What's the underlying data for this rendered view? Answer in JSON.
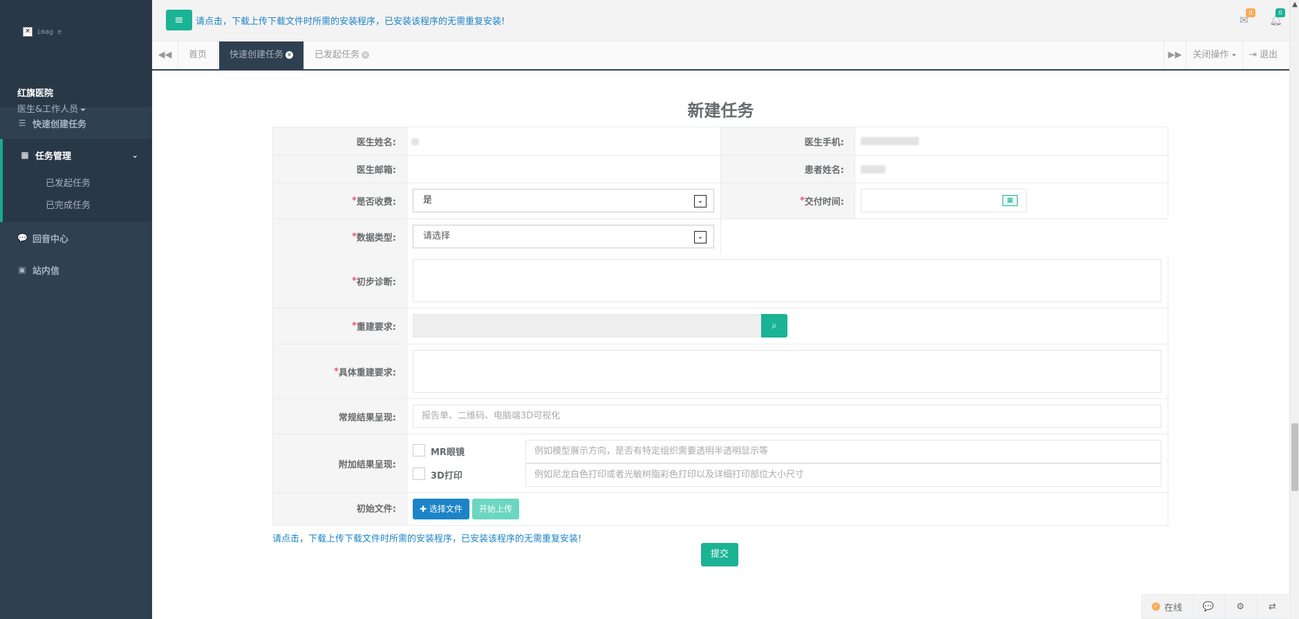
{
  "sidebar": {
    "avatar_alt": "imag e",
    "hospital": "红旗医院",
    "role": "医生&工作人员",
    "items": [
      {
        "label": "快速创建任务",
        "icon": "sliders-icon"
      },
      {
        "label": "任务管理",
        "icon": "list-icon",
        "expanded": true,
        "children": [
          {
            "label": "已发起任务"
          },
          {
            "label": "已完成任务"
          }
        ]
      },
      {
        "label": "回音中心",
        "icon": "chat-icon"
      },
      {
        "label": "站内信",
        "icon": "mail-box-icon"
      }
    ]
  },
  "topbar": {
    "notice": "请点击，下载上传下载文件时所需的安装程序，已安装该程序的无需重复安装!",
    "mail_badge": "0",
    "bell_badge": "0"
  },
  "tabs": {
    "items": [
      {
        "label": "首页",
        "active": false,
        "closable": false
      },
      {
        "label": "快速创建任务",
        "active": true,
        "closable": true
      },
      {
        "label": "已发起任务",
        "active": false,
        "closable": true
      }
    ],
    "close_ops": "关闭操作",
    "logout": "退出"
  },
  "form": {
    "title": "新建任务",
    "doctor_name_label": "医生姓名:",
    "doctor_phone_label": "医生手机:",
    "doctor_email_label": "医生邮箱:",
    "patient_name_label": "患者姓名:",
    "charge_label": "是否收费:",
    "charge_value": "是",
    "delivery_label": "交付时间:",
    "data_type_label": "数据类型:",
    "data_type_value": "请选择",
    "diagnosis_label": "初步诊断:",
    "rebuild_req_label": "重建要求:",
    "specific_req_label": "具体重建要求:",
    "regular_result_label": "常规结果呈现:",
    "regular_result_placeholder": "报告单、二维码、电脑端3D可视化",
    "extra_result_label": "附加结果呈现:",
    "mr_label": "MR眼镜",
    "mr_placeholder": "例如模型展示方向，是否有特定组织需要透明半透明显示等",
    "print_label": "3D打印",
    "print_placeholder": "例如尼龙白色打印或者光敏树脂彩色打印以及详细打印部位大小尺寸",
    "initial_file_label": "初始文件:",
    "choose_file": "选择文件",
    "start_upload": "开始上传",
    "required_mark": "*"
  },
  "bottom_notice": "请点击，下载上传下载文件时所需的安装程序，已安装该程序的无需重复安装!",
  "submit": "提交",
  "footer": {
    "online": "在线"
  }
}
